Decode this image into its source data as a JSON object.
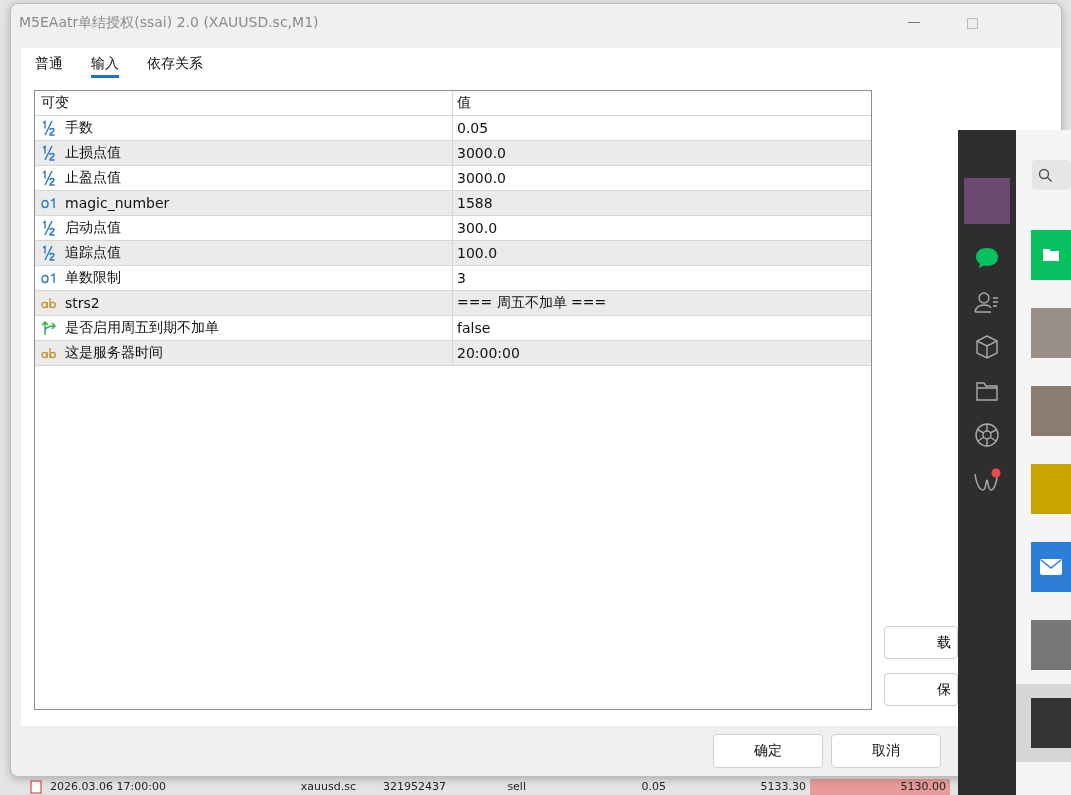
{
  "window": {
    "title": "M5EAatr单结授权(ssai) 2.0 (XAUUSD.sc,M1)"
  },
  "tabs": [
    {
      "label": "普通",
      "selected": false
    },
    {
      "label": "输入",
      "selected": true
    },
    {
      "label": "依存关系",
      "selected": false
    }
  ],
  "table": {
    "columns": [
      "可变",
      "值"
    ],
    "rows": [
      {
        "kind": "double",
        "name": "手数",
        "value": "0.05"
      },
      {
        "kind": "double",
        "name": "止损点值",
        "value": "3000.0"
      },
      {
        "kind": "double",
        "name": "止盈点值",
        "value": "3000.0"
      },
      {
        "kind": "int",
        "name": "magic_number",
        "value": "1588"
      },
      {
        "kind": "double",
        "name": "启动点值",
        "value": "300.0"
      },
      {
        "kind": "double",
        "name": "追踪点值",
        "value": "100.0"
      },
      {
        "kind": "int",
        "name": "单数限制",
        "value": "3"
      },
      {
        "kind": "string",
        "name": "strs2",
        "value": "=== 周五不加单 ==="
      },
      {
        "kind": "bool",
        "name": "是否启用周五到期不加单",
        "value": "false"
      },
      {
        "kind": "string",
        "name": "这是服务器时间",
        "value": "20:00:00"
      }
    ]
  },
  "side_buttons": [
    "载",
    "保"
  ],
  "buttons": [
    "确定",
    "取消"
  ],
  "background_row": [
    "2026.03.06 17:00:00",
    "xauusd.sc",
    "321952437",
    "sell",
    "0.05",
    "5133.30",
    "5130.00"
  ]
}
